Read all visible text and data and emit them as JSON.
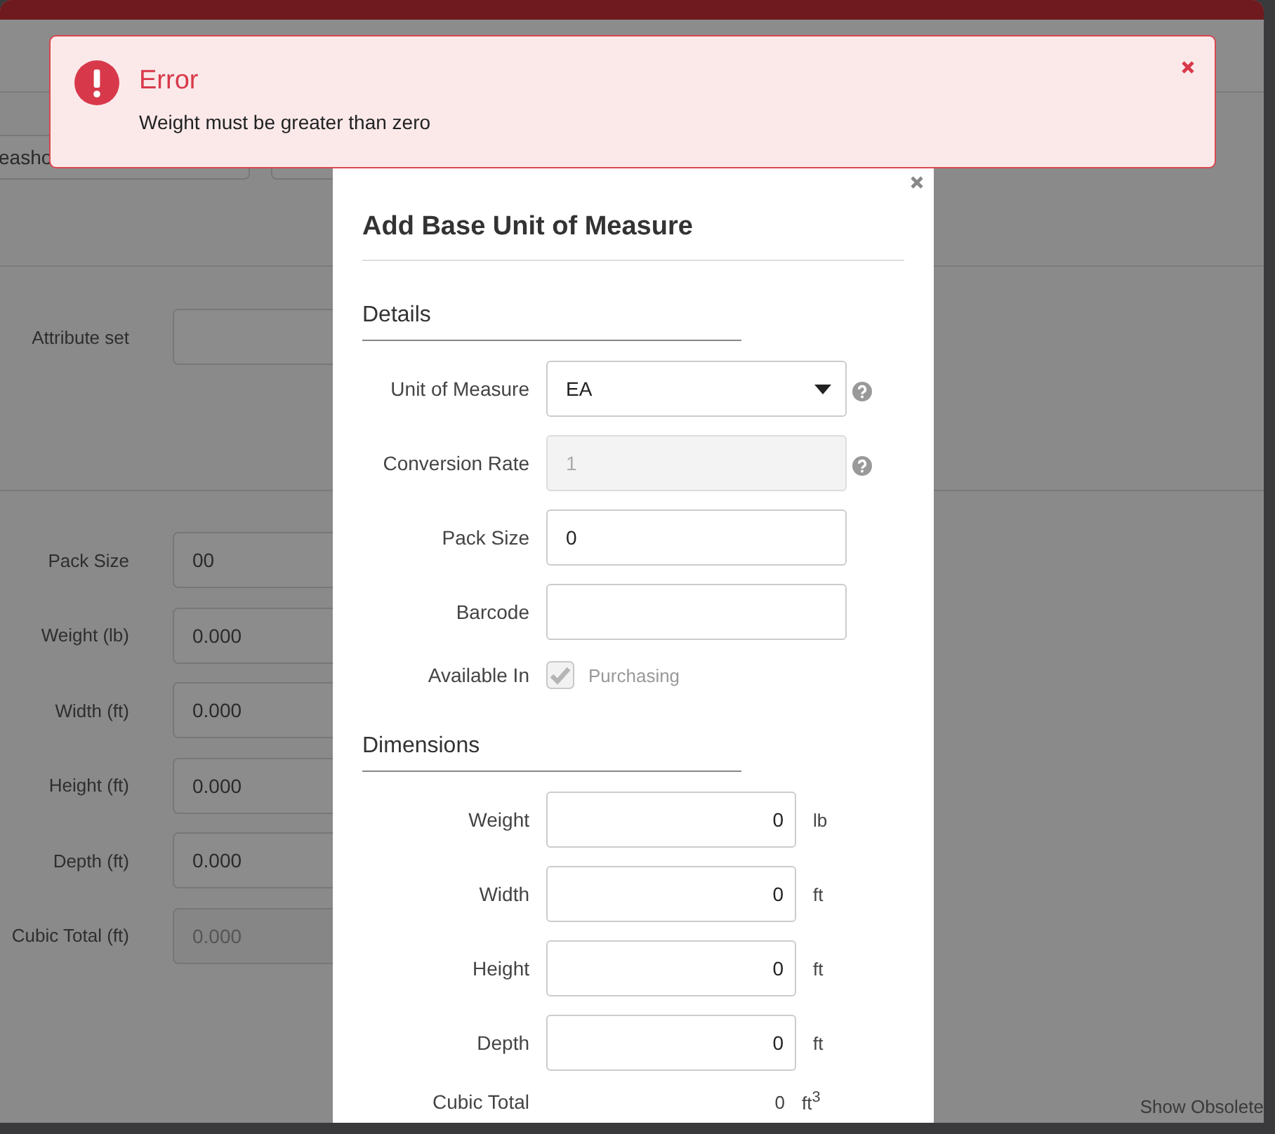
{
  "toast": {
    "title": "Error",
    "message": "Weight must be greater than zero"
  },
  "background": {
    "top_fields": [
      {
        "kind": "input",
        "value": "easho"
      },
      {
        "kind": "input"
      }
    ],
    "attribute_set": {
      "label": "Attribute set"
    },
    "fields": [
      {
        "label": "Pack Size",
        "value": "00",
        "disabled": false
      },
      {
        "label": "Weight (lb)",
        "value": "0.000",
        "disabled": false
      },
      {
        "label": "Width (ft)",
        "value": "0.000",
        "disabled": false
      },
      {
        "label": "Height (ft)",
        "value": "0.000",
        "disabled": false
      },
      {
        "label": "Depth (ft)",
        "value": "0.000",
        "disabled": false
      },
      {
        "label": "Cubic Total (ft)",
        "value": "0.000",
        "disabled": true
      }
    ],
    "footer_link": "Show Obsolete"
  },
  "dialog": {
    "title": "Add Base Unit of Measure",
    "sections": [
      {
        "heading": "Details",
        "rows": [
          {
            "kind": "select",
            "label": "Unit of Measure",
            "value": "EA",
            "help": true
          },
          {
            "kind": "text",
            "label": "Conversion Rate",
            "value": "1",
            "disabled": true,
            "help": true
          },
          {
            "kind": "text",
            "label": "Pack Size",
            "value": "0",
            "disabled": false,
            "help": false
          },
          {
            "kind": "text",
            "label": "Barcode",
            "disabled": false,
            "help": false
          },
          {
            "kind": "checkbox",
            "label": "Available In",
            "option": "Purchasing",
            "checked": true,
            "disabled": true
          }
        ]
      },
      {
        "heading": "Dimensions",
        "rows": [
          {
            "kind": "number",
            "label": "Weight",
            "value": "0",
            "unit": "lb"
          },
          {
            "kind": "number",
            "label": "Width",
            "value": "0",
            "unit": "ft"
          },
          {
            "kind": "number",
            "label": "Height",
            "value": "0",
            "unit": "ft"
          },
          {
            "kind": "number",
            "label": "Depth",
            "value": "0",
            "unit": "ft"
          },
          {
            "kind": "readout",
            "label": "Cubic Total",
            "value": "0",
            "unit": "ft$^{3}$"
          }
        ]
      }
    ]
  }
}
